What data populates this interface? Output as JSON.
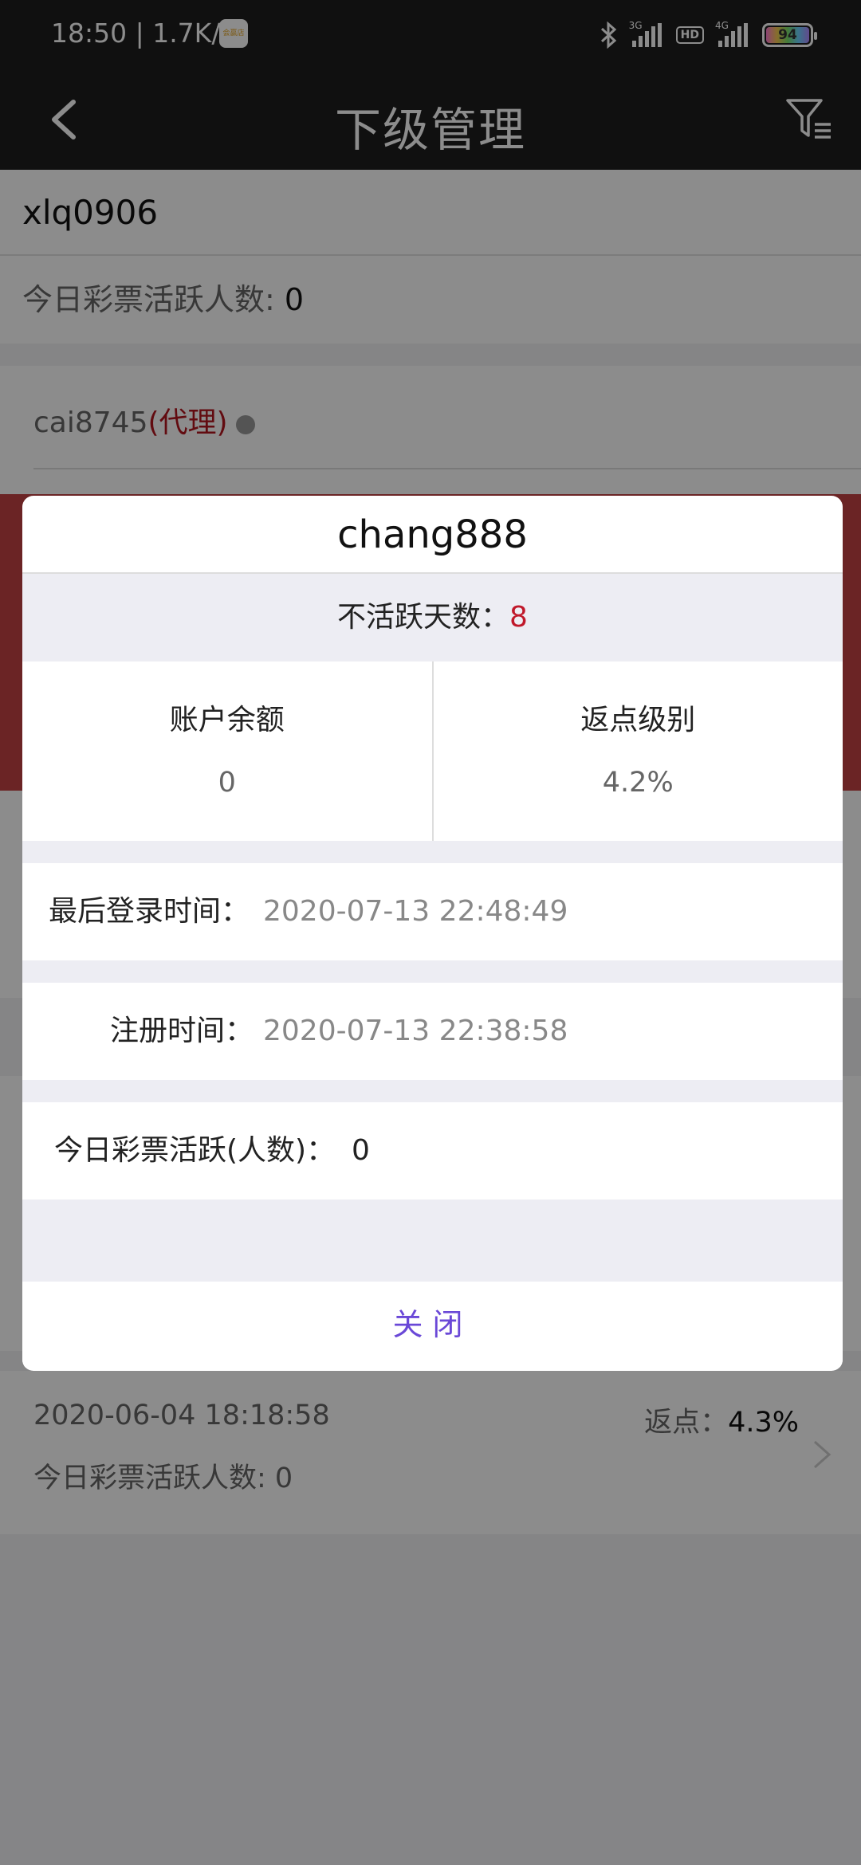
{
  "status_bar": {
    "time_speed": "18:50 | 1.7K/s",
    "app_icon_text": "会赢店",
    "signal1_label": "3G",
    "hd_label": "HD",
    "signal2_label": "4G",
    "battery_level": "94"
  },
  "nav": {
    "title": "下级管理",
    "back_icon": "chevron-left-icon",
    "filter_icon": "filter-icon"
  },
  "background": {
    "user_row": "xlq0906",
    "active_label": "今日彩票活跃人数: ",
    "active_value": "0",
    "card1_name": "cai8745",
    "card1_agent": "(代理)",
    "bottom_date": "2020-06-04 18:18:58",
    "bottom_active": "今日彩票活跃人数: 0",
    "bottom_rebate_label": "返点：",
    "bottom_rebate_value": "4.3%"
  },
  "modal": {
    "title": "chang888",
    "inactive_label": "不活跃天数：",
    "inactive_value": "8",
    "balance_label": "账户余额",
    "balance_value": "0",
    "rebate_label": "返点级别",
    "rebate_value": "4.2%",
    "last_login_label": "最后登录时间：",
    "last_login_value": "2020-07-13 22:48:49",
    "register_label": "注册时间：",
    "register_value": "2020-07-13 22:38:58",
    "today_active_label": "今日彩票活跃(人数)：",
    "today_active_value": "0",
    "close_label": "关闭"
  }
}
